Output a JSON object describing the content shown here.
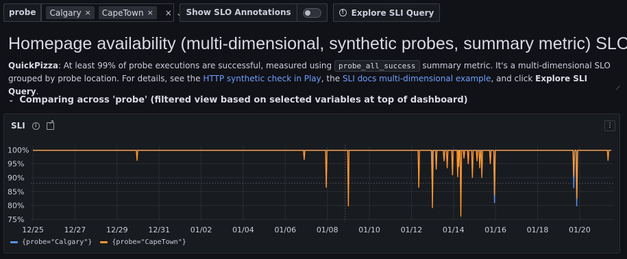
{
  "variables": {
    "label": "probe",
    "values": [
      "Calgary",
      "CapeTown"
    ],
    "clear_symbol": "×",
    "chevron_symbol": "⌄"
  },
  "annotations_toggle": {
    "label": "Show SLO Annotations",
    "on": false
  },
  "explore_button": {
    "label": "Explore SLI Query"
  },
  "page_title": "Homepage availability (multi-dimensional, synthetic probes, summary metric) SLO",
  "description": {
    "brand": "QuickPizza",
    "text1": ": At least 99% of probe executions are successful, measured using ",
    "code": "probe_all_success",
    "text2": " summary metric. It's a multi-dimensional SLO grouped by probe location. For details, see the ",
    "link1": "HTTP synthetic check in Play",
    "text3": ", the ",
    "link2": "SLI docs multi-dimensional example",
    "text4": ", and click ",
    "bold_end": "Explore SLI Query",
    "text5": "."
  },
  "row": {
    "title": "Comparing across 'probe' (filtered view based on selected variables at top of dashboard)"
  },
  "panel": {
    "title": "SLI"
  },
  "colors": {
    "calgary": "#5794f2",
    "capetown": "#ff9830"
  },
  "chart_data": {
    "type": "line",
    "ytick_labels": [
      "100%",
      "95%",
      "90%",
      "85%",
      "80%",
      "75%"
    ],
    "yticks": [
      100,
      95,
      90,
      85,
      80,
      75
    ],
    "ylim": [
      74.5,
      100.8
    ],
    "xtick_labels": [
      "12/25",
      "12/27",
      "12/29",
      "12/31",
      "01/02",
      "01/04",
      "01/06",
      "01/08",
      "01/10",
      "01/12",
      "01/14",
      "01/16",
      "01/18",
      "01/20"
    ],
    "xtick_days": [
      0,
      2,
      4,
      6,
      8,
      10,
      12,
      14,
      16,
      18,
      20,
      22,
      24,
      26
    ],
    "xlim_days": [
      -0.1,
      27.6
    ],
    "baseline": 99.8,
    "series": [
      {
        "name": "{probe=\"Calgary\"}",
        "color": "#5794f2",
        "dips": [
          [
            18.98,
            89.5
          ],
          [
            21.95,
            81.0
          ],
          [
            25.72,
            86.3
          ],
          [
            25.86,
            79.8
          ]
        ]
      },
      {
        "name": "{probe=\"CapeTown\"}",
        "color": "#ff9830",
        "dips": [
          [
            4.95,
            96.2
          ],
          [
            12.9,
            96.5
          ],
          [
            13.95,
            86.5
          ],
          [
            15.0,
            79.8
          ],
          [
            18.35,
            86.5
          ],
          [
            19.0,
            79.2
          ],
          [
            19.18,
            93.0
          ],
          [
            19.55,
            96.0
          ],
          [
            19.7,
            93.5
          ],
          [
            19.95,
            91.0
          ],
          [
            20.2,
            90.3
          ],
          [
            20.25,
            94.0
          ],
          [
            20.35,
            76.1
          ],
          [
            20.5,
            97.0
          ],
          [
            20.7,
            95.0
          ],
          [
            20.9,
            90.0
          ],
          [
            21.12,
            96.0
          ],
          [
            21.25,
            93.5
          ],
          [
            21.35,
            90.0
          ],
          [
            21.75,
            95.0
          ],
          [
            21.95,
            83.8
          ],
          [
            25.72,
            90.3
          ],
          [
            25.87,
            82.5
          ],
          [
            27.35,
            96.2
          ]
        ]
      }
    ]
  }
}
